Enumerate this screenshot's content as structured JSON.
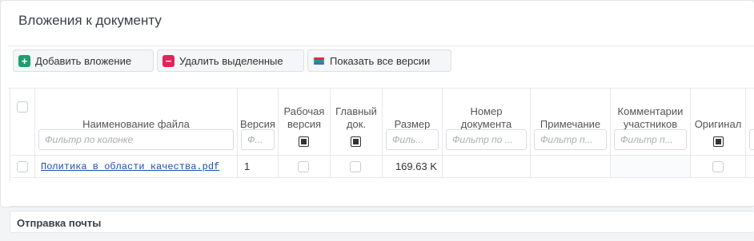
{
  "dialog": {
    "title": "Вложения к документу"
  },
  "toolbar": {
    "add_label": "Добавить вложение",
    "delete_label": "Удалить выделенные",
    "versions_label": "Показать все версии"
  },
  "colors": {
    "add_icon": "#1f9e6d",
    "delete_icon": "#e2245a",
    "versions_icon": [
      "#e2245a",
      "#1f9e6d",
      "#3b6fd6"
    ]
  },
  "table": {
    "columns": [
      {
        "label": "Наименование файла",
        "filter_placeholder": "Фильтр по колонке"
      },
      {
        "label": "Версия",
        "filter_placeholder": "Ф..."
      },
      {
        "label": "Рабочая версия",
        "filter": "checkbox"
      },
      {
        "label": "Главный док.",
        "filter": "checkbox"
      },
      {
        "label": "Размер",
        "filter_placeholder": "Филь..."
      },
      {
        "label": "Номер документа",
        "filter_placeholder": "Фильтр по ..."
      },
      {
        "label": "Примечание",
        "filter_placeholder": "Фильтр п..."
      },
      {
        "label": "Комментарии участников",
        "filter_placeholder": "Фильтр п..."
      },
      {
        "label": "Оригинал",
        "filter": "checkbox"
      }
    ],
    "rows": [
      {
        "file_name": "Политика в области качества.pdf",
        "version": "1",
        "working_version": false,
        "main_doc": false,
        "size": "169.63 K",
        "doc_number": "",
        "note": "",
        "comments": "",
        "original": false
      }
    ]
  },
  "mail_section": {
    "title": "Отправка почты"
  }
}
